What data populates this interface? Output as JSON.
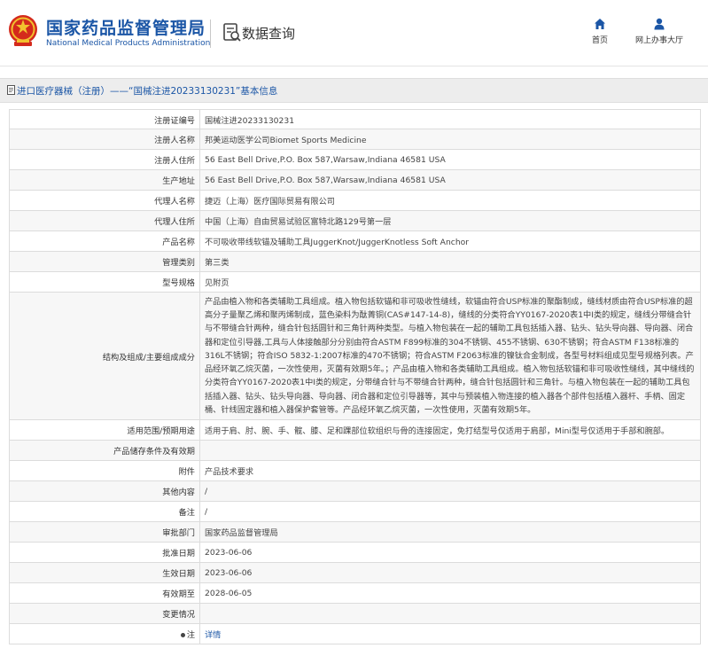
{
  "header": {
    "logo_cn": "国家药品监督管理局",
    "logo_en": "National Medical Products Administration",
    "query_label": "数据查询",
    "nav": {
      "home": "首页",
      "hall": "网上办事大厅"
    }
  },
  "breadcrumb": {
    "text": "进口医疗器械（注册）——“国械注进20233130231”基本信息"
  },
  "rows": [
    {
      "label": "注册证编号",
      "value": "国械注进20233130231"
    },
    {
      "label": "注册人名称",
      "value": "邦美运动医学公司Biomet Sports Medicine"
    },
    {
      "label": "注册人住所",
      "value": "56 East Bell Drive,P.O. Box 587,Warsaw,Indiana 46581 USA"
    },
    {
      "label": "生产地址",
      "value": "56 East Bell Drive,P.O. Box 587,Warsaw,Indiana 46581 USA"
    },
    {
      "label": "代理人名称",
      "value": "捷迈（上海）医疗国际贸易有限公司"
    },
    {
      "label": "代理人住所",
      "value": "中国（上海）自由贸易试验区富特北路129号第一层"
    },
    {
      "label": "产品名称",
      "value": "不可吸收带线软锚及辅助工具JuggerKnot/JuggerKnotless Soft Anchor"
    },
    {
      "label": "管理类别",
      "value": "第三类"
    },
    {
      "label": "型号规格",
      "value": "见附页"
    },
    {
      "label": "结构及组成/主要组成成分",
      "value": "产品由植入物和各类辅助工具组成。植入物包括软锚和非可吸收性缝线，软锚由符合USP标准的聚酯制成，缝线材质由符合USP标准的超高分子量聚乙烯和聚丙烯制成，蓝色染料为酞菁铜(CAS#147-14-8)，缝线的分类符合YY0167-2020表1中I类的规定，缝线分带缝合针与不带缝合针两种，缝合针包括圆针和三角针两种类型。与植入物包装在一起的辅助工具包括插入器、钻头、钻头导向器、导向器、闭合器和定位引导器,工具与人体接触部分分别由符合ASTM F899标准的304不锈钢、455不锈钢、630不锈钢；符合ASTM F138标准的316L不锈钢；符合ISO 5832-1:2007标准的470不锈钢；符合ASTM F2063标准的镍钛合金制成，各型号材料组成见型号规格列表。产品经环氧乙烷灭菌，一次性使用，灭菌有效期5年。；产品由植入物和各类辅助工具组成。植入物包括软锚和非可吸收性缝线，其中缝线的分类符合YY0167-2020表1中I类的规定，分带缝合针与不带缝合针两种，缝合针包括圆针和三角针。与植入物包装在一起的辅助工具包括插入器、钻头、钻头导向器、导向器、闭合器和定位引导器等，其中与预装植入物连接的植入器各个部件包括植入器杆、手柄、固定桶、针线固定器和植入器保护套管等。产品经环氧乙烷灭菌，一次性使用，灭菌有效期5年。"
    },
    {
      "label": "适用范围/预期用途",
      "value": "适用于肩、肘、腕、手、髋、膝、足和踝部位软组织与骨的连接固定，免打结型号仅适用于肩部，Mini型号仅适用于手部和腕部。"
    },
    {
      "label": "产品储存条件及有效期",
      "value": ""
    },
    {
      "label": "附件",
      "value": "产品技术要求"
    },
    {
      "label": "其他内容",
      "value": "/"
    },
    {
      "label": "备注",
      "value": "/"
    },
    {
      "label": "审批部门",
      "value": "国家药品监督管理局"
    },
    {
      "label": "批准日期",
      "value": "2023-06-06"
    },
    {
      "label": "生效日期",
      "value": "2023-06-06"
    },
    {
      "label": "有效期至",
      "value": "2028-06-05"
    },
    {
      "label": "变更情况",
      "value": ""
    },
    {
      "label": "注",
      "value": "详情"
    }
  ]
}
